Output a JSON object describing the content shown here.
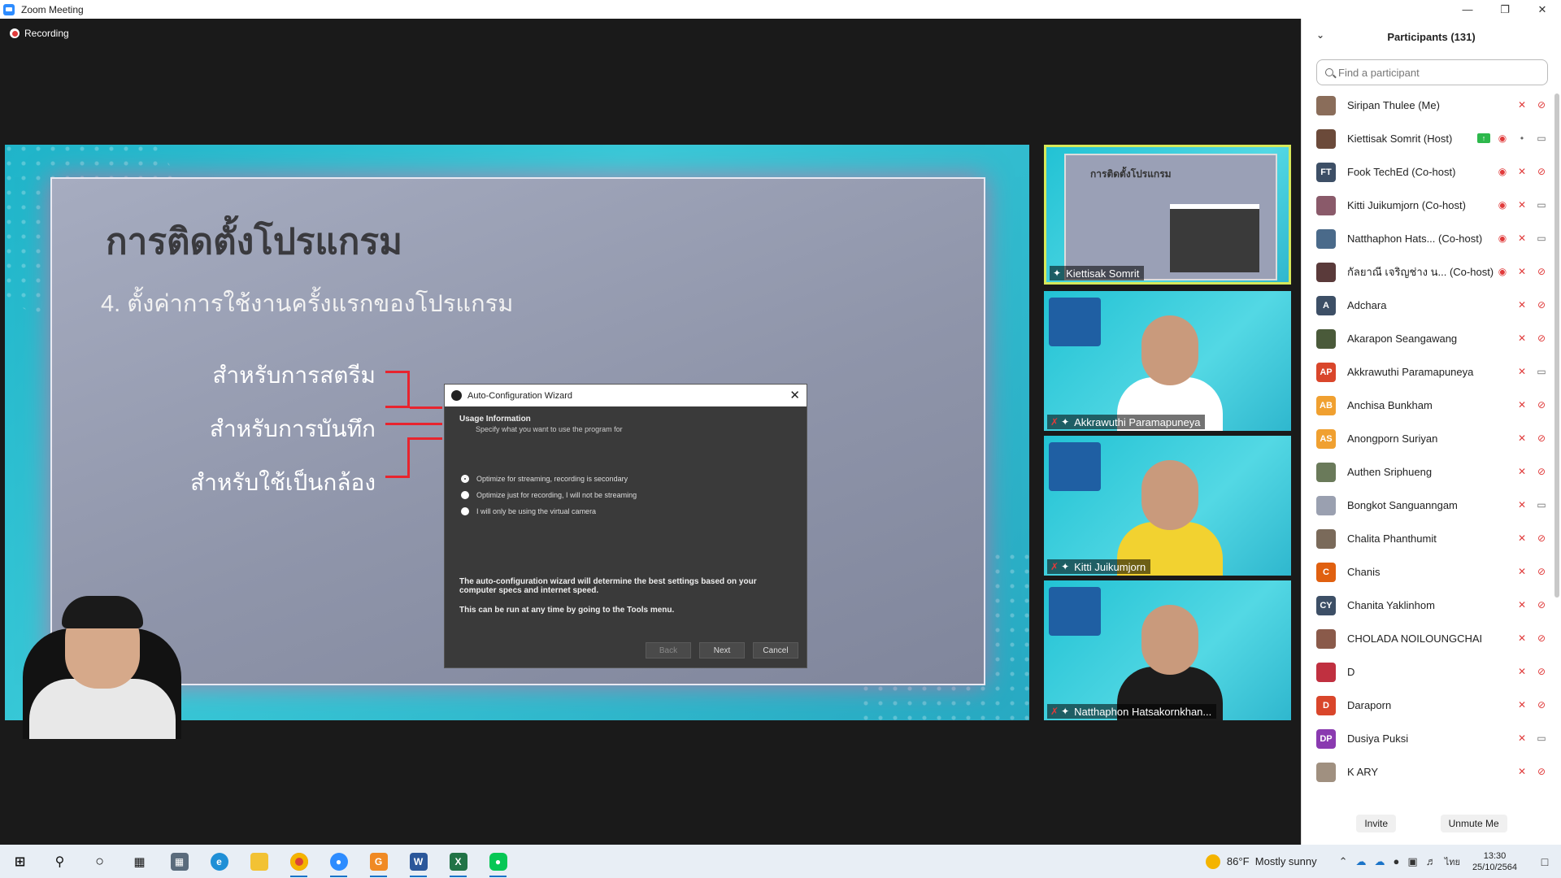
{
  "window": {
    "title": "Zoom Meeting"
  },
  "meeting": {
    "recording_label": "Recording"
  },
  "slide": {
    "title": "การติดตั้งโปรแกรม",
    "subtitle": "4. ตั้งค่าการใช้งานครั้งแรกของโปรแกรม",
    "options": [
      "สำหรับการสตรีม",
      "สำหรับการบันทึก",
      "สำหรับใช้เป็นกล้อง"
    ]
  },
  "obs_dialog": {
    "title": "Auto-Configuration Wizard",
    "heading": "Usage Information",
    "description": "Specify what you want to use the program for",
    "radios": [
      "Optimize for streaming, recording is secondary",
      "Optimize just for recording, I will not be streaming",
      "I will only be using the virtual camera"
    ],
    "note1": "The auto-configuration wizard will determine the best settings based on your computer specs and internet speed.",
    "note2": "This can be run at any time by going to the Tools menu.",
    "back": "Back",
    "next": "Next",
    "cancel": "Cancel"
  },
  "tiles": [
    {
      "name": "Kiettisak Somrit"
    },
    {
      "name": "Akkrawuthi Paramapuneya"
    },
    {
      "name": "Kitti Juikumjorn"
    },
    {
      "name": "Natthaphon Hatsakornkhan..."
    }
  ],
  "tile_mini_title": "การติดตั้งโปรแกรม",
  "panel": {
    "title": "Participants (131)",
    "search_placeholder": "Find a participant",
    "invite": "Invite",
    "unmute": "Unmute Me"
  },
  "participants": [
    {
      "name": "Siripan Thulee (Me)",
      "avatar": "",
      "color": "#8a6d5a",
      "icons": [
        "mic-off",
        "cam-off"
      ]
    },
    {
      "name": "Kiettisak Somrit (Host)",
      "avatar": "",
      "color": "#6b4a3a",
      "icons": [
        "share",
        "rec",
        "mic",
        "cam"
      ]
    },
    {
      "name": "Fook TechEd (Co-host)",
      "avatar": "FT",
      "color": "#3d4f66",
      "icons": [
        "rec",
        "mic-off",
        "cam-off"
      ]
    },
    {
      "name": "Kitti Juikumjorn (Co-host)",
      "avatar": "",
      "color": "#8a5a6a",
      "icons": [
        "rec",
        "mic-off",
        "cam"
      ]
    },
    {
      "name": "Natthaphon Hats...  (Co-host)",
      "avatar": "",
      "color": "#4a6a8a",
      "icons": [
        "rec",
        "mic-off",
        "cam"
      ]
    },
    {
      "name": "กัลยาณี เจริญช่าง น...  (Co-host)",
      "avatar": "",
      "color": "#5a3a3a",
      "icons": [
        "rec",
        "mic-off",
        "cam-off"
      ]
    },
    {
      "name": "Adchara",
      "avatar": "A",
      "color": "#3d4f66",
      "icons": [
        "mic-off",
        "cam-off"
      ]
    },
    {
      "name": "Akarapon Seangawang",
      "avatar": "",
      "color": "#4a5a3a",
      "icons": [
        "mic-off",
        "cam-off"
      ]
    },
    {
      "name": "Akkrawuthi Paramapuneya",
      "avatar": "AP",
      "color": "#d9462b",
      "icons": [
        "mic-off",
        "cam"
      ]
    },
    {
      "name": "Anchisa Bunkham",
      "avatar": "AB",
      "color": "#f0a030",
      "icons": [
        "mic-off",
        "cam-off"
      ]
    },
    {
      "name": "Anongporn Suriyan",
      "avatar": "AS",
      "color": "#f0a030",
      "icons": [
        "mic-off",
        "cam-off"
      ]
    },
    {
      "name": "Authen Sriphueng",
      "avatar": "",
      "color": "#6a7a5a",
      "icons": [
        "mic-off",
        "cam-off"
      ]
    },
    {
      "name": "Bongkot Sanguanngam",
      "avatar": "",
      "color": "#9aa0b0",
      "icons": [
        "mic-off",
        "cam"
      ]
    },
    {
      "name": "Chalita Phanthumit",
      "avatar": "",
      "color": "#7a6a5a",
      "icons": [
        "mic-off",
        "cam-off"
      ]
    },
    {
      "name": "Chanis",
      "avatar": "C",
      "color": "#e06010",
      "icons": [
        "mic-off",
        "cam-off"
      ]
    },
    {
      "name": "Chanita Yaklinhom",
      "avatar": "CY",
      "color": "#3d4f66",
      "icons": [
        "mic-off",
        "cam-off"
      ]
    },
    {
      "name": "CHOLADA NOILOUNGCHAI",
      "avatar": "",
      "color": "#8a5a4a",
      "icons": [
        "mic-off",
        "cam-off"
      ]
    },
    {
      "name": "D",
      "avatar": "",
      "color": "#c03040",
      "icons": [
        "mic-off",
        "cam-off"
      ]
    },
    {
      "name": "Daraporn",
      "avatar": "D",
      "color": "#d9462b",
      "icons": [
        "mic-off",
        "cam-off"
      ]
    },
    {
      "name": "Dusiya Puksi",
      "avatar": "DP",
      "color": "#8a3ab0",
      "icons": [
        "mic-off",
        "cam"
      ]
    },
    {
      "name": "K ARY",
      "avatar": "",
      "color": "#a09080",
      "icons": [
        "mic-off",
        "cam-off"
      ]
    }
  ],
  "taskbar": {
    "temperature": "86°F",
    "weather": "Mostly sunny",
    "language": "ไทย",
    "time": "13:30",
    "date": "25/10/2564"
  }
}
